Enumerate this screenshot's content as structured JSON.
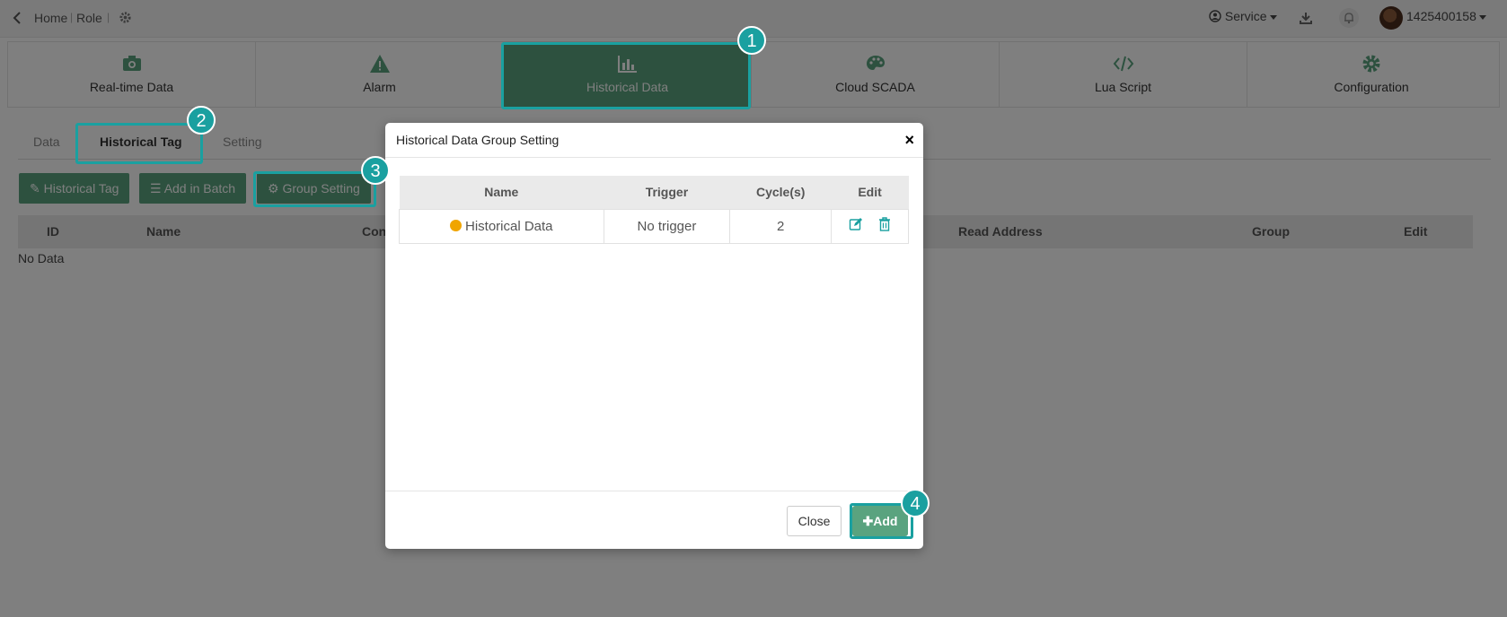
{
  "topbar": {
    "breadcrumb": [
      "Home",
      "Role"
    ],
    "service_label": "Service",
    "user_id": "1425400158"
  },
  "main_nav": [
    {
      "label": "Real-time Data",
      "icon": "camera-icon"
    },
    {
      "label": "Alarm",
      "icon": "warning-icon"
    },
    {
      "label": "Historical Data",
      "icon": "bar-chart-icon",
      "active": true
    },
    {
      "label": "Cloud SCADA",
      "icon": "palette-icon"
    },
    {
      "label": "Lua Script",
      "icon": "code-icon"
    },
    {
      "label": "Configuration",
      "icon": "gear-icon"
    }
  ],
  "sub_tabs": [
    {
      "label": "Data"
    },
    {
      "label": "Historical Tag",
      "active": true
    },
    {
      "label": "Setting"
    }
  ],
  "toolbar": {
    "historical_tag": "Historical Tag",
    "add_in_batch": "Add in Batch",
    "group_setting": "Group Setting"
  },
  "tag_table": {
    "columns": [
      "ID",
      "Name",
      "Con",
      "Read Address",
      "Group",
      "Edit"
    ],
    "empty_text": "No Data"
  },
  "modal": {
    "title": "Historical Data Group Setting",
    "close_symbol": "×",
    "columns": [
      "Name",
      "Trigger",
      "Cycle(s)",
      "Edit"
    ],
    "rows": [
      {
        "name": "Historical Data",
        "trigger": "No trigger",
        "cycle": "2"
      }
    ],
    "close_label": "Close",
    "add_label": "Add"
  },
  "steps": [
    "1",
    "2",
    "3",
    "4"
  ],
  "colors": {
    "accent": "#5aa37f",
    "highlight": "#1aa0a0",
    "status_dot": "#f0a500"
  }
}
